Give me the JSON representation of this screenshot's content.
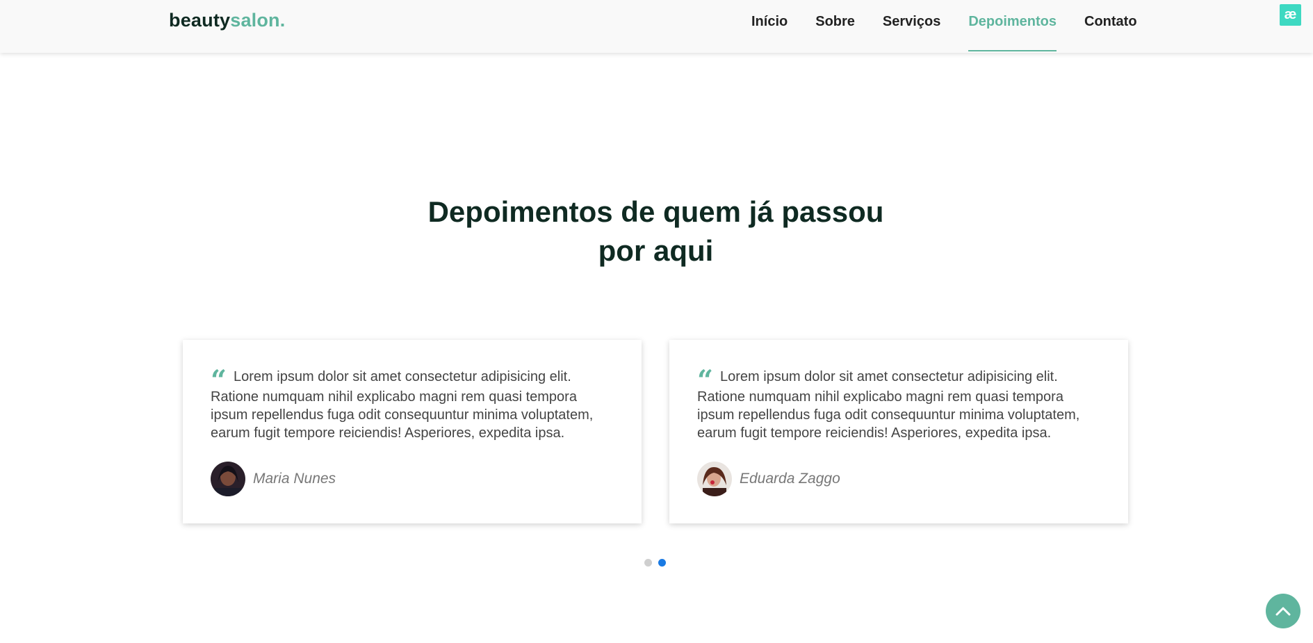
{
  "header": {
    "logo_main": "beauty",
    "logo_accent": "salon.",
    "nav": [
      {
        "label": "Início",
        "active": false
      },
      {
        "label": "Sobre",
        "active": false
      },
      {
        "label": "Serviços",
        "active": false
      },
      {
        "label": "Depoimentos",
        "active": true
      },
      {
        "label": "Contato",
        "active": false
      }
    ],
    "extension_icon_glyph": "æ"
  },
  "testimonials": {
    "title_line1": "Depoimentos de quem já passou",
    "title_line2": "por aqui",
    "items": [
      {
        "text": "Lorem ipsum dolor sit amet consectetur adipisicing elit. Ratione numquam nihil explicabo magni rem quasi tempora ipsum repellendus fuga odit consequuntur minima voluptatem, earum fugit tempore reiciendis! Asperiores, expedita ipsa.",
        "author": "Maria Nunes"
      },
      {
        "text": "Lorem ipsum dolor sit amet consectetur adipisicing elit. Ratione numquam nihil explicabo magni rem quasi tempora ipsum repellendus fuga odit consequuntur minima voluptatem, earum fugit tempore reiciendis! Asperiores, expedita ipsa.",
        "author": "Eduarda Zaggo"
      }
    ],
    "pagination": {
      "pages": 2,
      "active_index": 1
    }
  },
  "colors": {
    "accent": "#5fb59e",
    "dark": "#0f2a22",
    "dot_active": "#1a7ae3"
  },
  "icons": {
    "quote": "quote-icon",
    "back_to_top": "chevron-up-icon"
  }
}
